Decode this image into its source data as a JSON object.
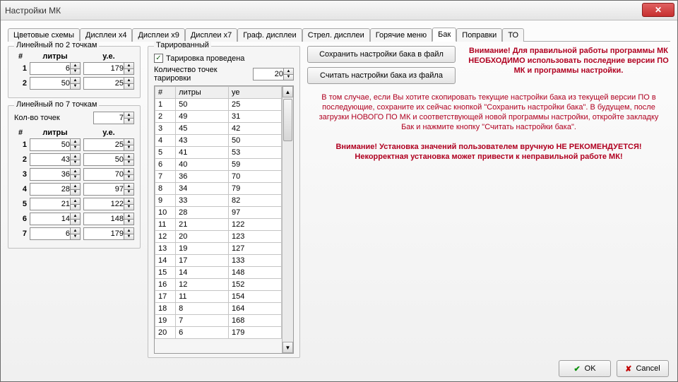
{
  "window": {
    "title": "Настройки МК"
  },
  "tabs": [
    "Цветовые схемы",
    "Дисплеи x4",
    "Дисплеи x9",
    "Дисплеи x7",
    "Граф. дисплеи",
    "Стрел. дисплеи",
    "Горячие меню",
    "Бак",
    "Поправки",
    "ТО"
  ],
  "active_tab": 7,
  "linear2": {
    "legend": "Линейный по 2 точкам",
    "hdr_num": "#",
    "hdr_lit": "литры",
    "hdr_ue": "у.е.",
    "rows": [
      {
        "n": "1",
        "lit": "6",
        "ue": "179"
      },
      {
        "n": "2",
        "lit": "50",
        "ue": "25"
      }
    ]
  },
  "linear7": {
    "legend": "Линейный по 7 точкам",
    "count_label": "Кол-во точек",
    "count_val": "7",
    "hdr_num": "#",
    "hdr_lit": "литры",
    "hdr_ue": "у.е.",
    "rows": [
      {
        "n": "1",
        "lit": "50",
        "ue": "25"
      },
      {
        "n": "2",
        "lit": "43",
        "ue": "50"
      },
      {
        "n": "3",
        "lit": "36",
        "ue": "70"
      },
      {
        "n": "4",
        "lit": "28",
        "ue": "97"
      },
      {
        "n": "5",
        "lit": "21",
        "ue": "122"
      },
      {
        "n": "6",
        "lit": "14",
        "ue": "148"
      },
      {
        "n": "7",
        "lit": "6",
        "ue": "179"
      }
    ]
  },
  "tar": {
    "legend": "Тарированный",
    "cb_label": "Тарировка проведена",
    "cb_checked": true,
    "count_label": "Количество точек тарировки",
    "count_val": "20",
    "grid_hdr_num": "#",
    "grid_hdr_lit": "литры",
    "grid_hdr_ue": "уе",
    "rows": [
      {
        "n": "1",
        "lit": "50",
        "ue": "25"
      },
      {
        "n": "2",
        "lit": "49",
        "ue": "31"
      },
      {
        "n": "3",
        "lit": "45",
        "ue": "42"
      },
      {
        "n": "4",
        "lit": "43",
        "ue": "50"
      },
      {
        "n": "5",
        "lit": "41",
        "ue": "53"
      },
      {
        "n": "6",
        "lit": "40",
        "ue": "59"
      },
      {
        "n": "7",
        "lit": "36",
        "ue": "70"
      },
      {
        "n": "8",
        "lit": "34",
        "ue": "79"
      },
      {
        "n": "9",
        "lit": "33",
        "ue": "82"
      },
      {
        "n": "10",
        "lit": "28",
        "ue": "97"
      },
      {
        "n": "11",
        "lit": "21",
        "ue": "122"
      },
      {
        "n": "12",
        "lit": "20",
        "ue": "123"
      },
      {
        "n": "13",
        "lit": "19",
        "ue": "127"
      },
      {
        "n": "14",
        "lit": "17",
        "ue": "133"
      },
      {
        "n": "15",
        "lit": "14",
        "ue": "148"
      },
      {
        "n": "16",
        "lit": "12",
        "ue": "152"
      },
      {
        "n": "17",
        "lit": "11",
        "ue": "154"
      },
      {
        "n": "18",
        "lit": "8",
        "ue": "164"
      },
      {
        "n": "19",
        "lit": "7",
        "ue": "168"
      },
      {
        "n": "20",
        "lit": "6",
        "ue": "179"
      }
    ]
  },
  "buttons": {
    "save": "Сохранить настройки бака в файл",
    "load": "Считать настройки бака из файла",
    "ok": "OK",
    "cancel": "Cancel"
  },
  "texts": {
    "warn1": "Внимание! Для правильной работы программы МК НЕОБХОДИМО использовать последние версии ПО МК и программы настройки.",
    "info": "В том случае, если Вы хотите скопировать текущие настройки бака из текущей версии ПО в последующие, сохраните их сейчас кнопкой \"Сохранить настройки бака\". В будущем, после загрузки НОВОГО ПО МК и соответствующей новой программы настройки, откройте закладку Бак и нажмите кнопку \"Считать настройки бака\".",
    "warn2": "Внимание! Установка значений пользователем вручную НЕ РЕКОМЕНДУЕТСЯ! Некорректная установка может привести к неправильной работе МК!"
  }
}
